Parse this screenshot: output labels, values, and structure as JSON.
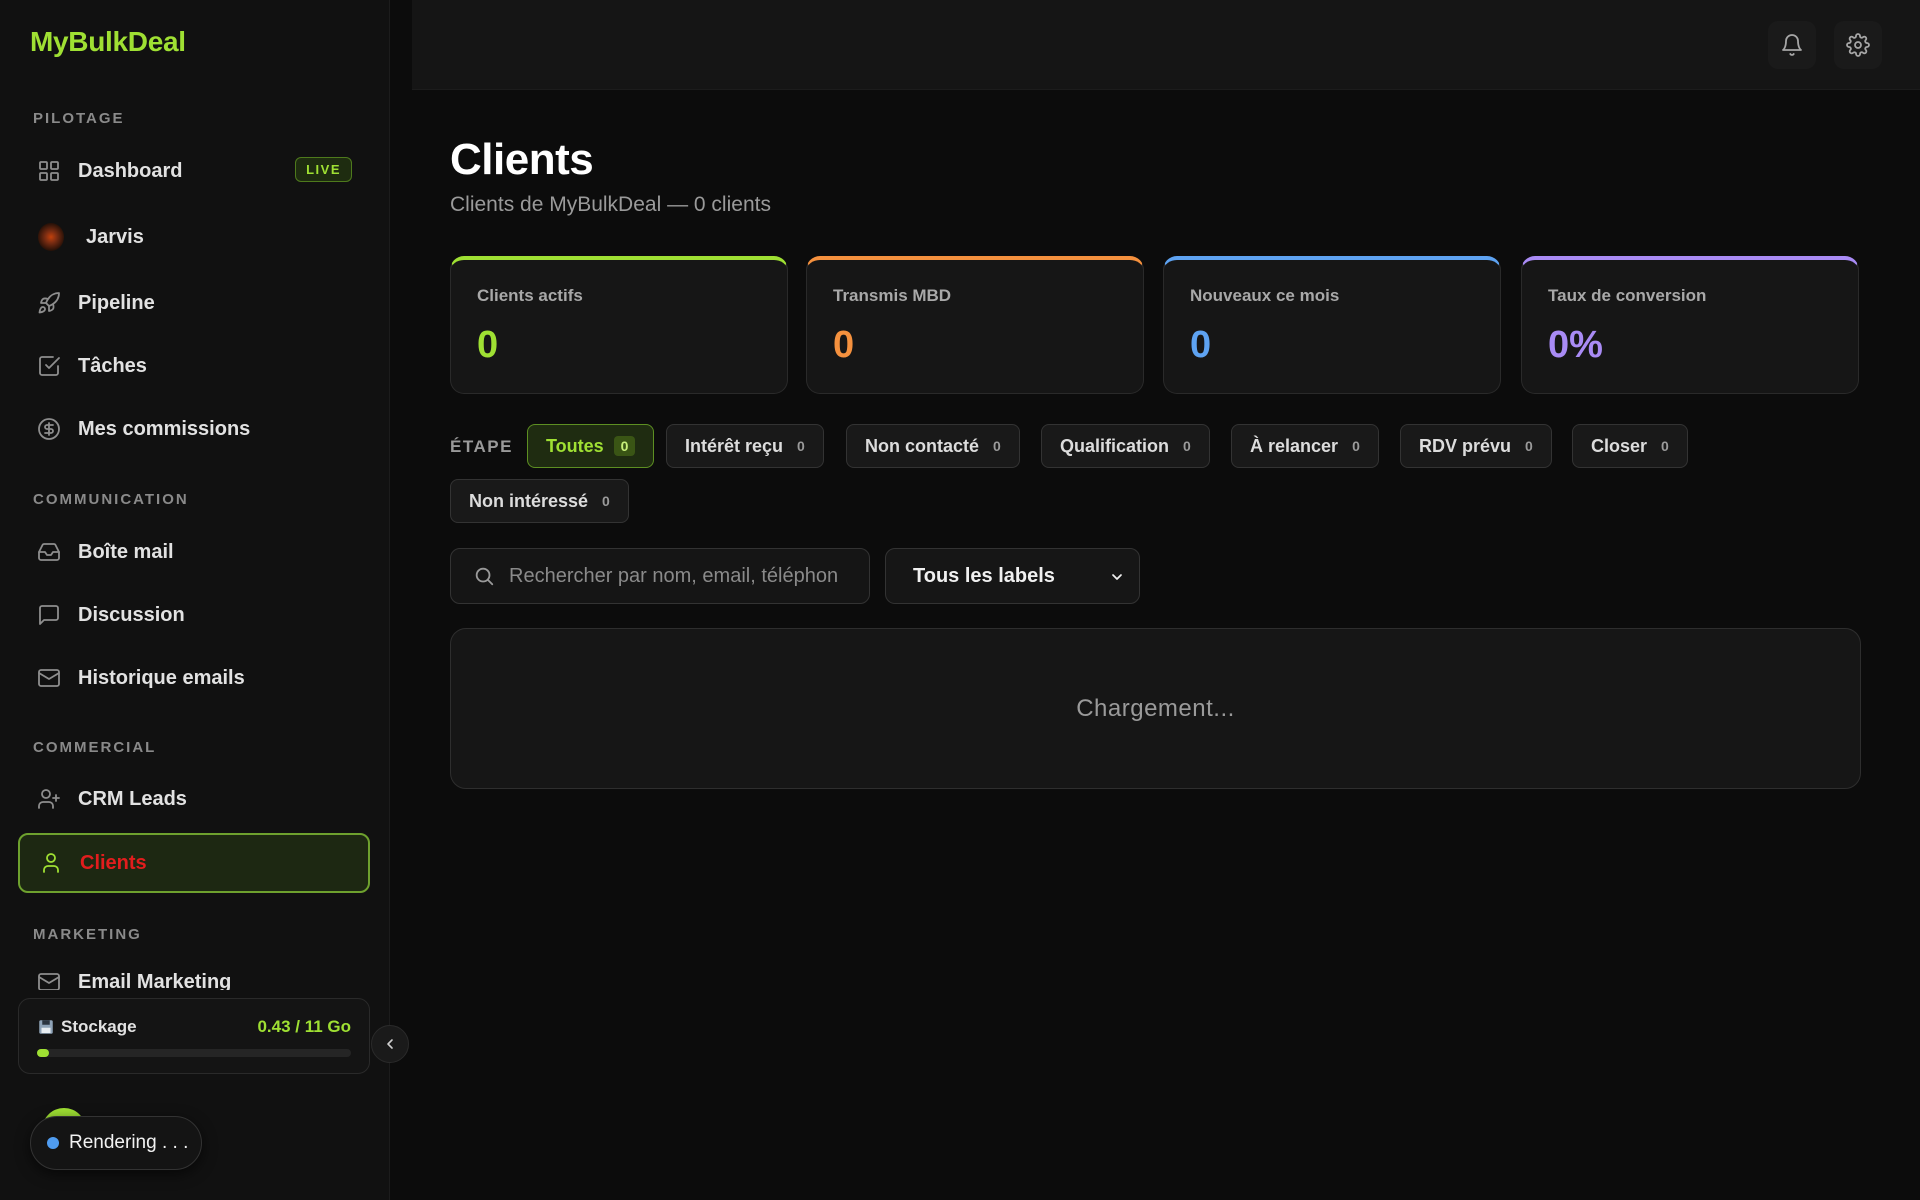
{
  "brand": "MyBulkDeal",
  "sidebar": {
    "sections": {
      "pilotage": "PILOTAGE",
      "communication": "COMMUNICATION",
      "commercial": "COMMERCIAL",
      "marketing": "MARKETING"
    },
    "items": {
      "dashboard": {
        "label": "Dashboard",
        "icon": "grid-icon",
        "badge": "LIVE"
      },
      "jarvis": {
        "label": "Jarvis",
        "icon": "jarvis-orb-icon"
      },
      "pipeline": {
        "label": "Pipeline",
        "icon": "rocket-icon"
      },
      "taches": {
        "label": "Tâches",
        "icon": "checkbox-icon"
      },
      "commissions": {
        "label": "Mes commissions",
        "icon": "dollar-circle-icon"
      },
      "boite_mail": {
        "label": "Boîte mail",
        "icon": "inbox-icon"
      },
      "discussion": {
        "label": "Discussion",
        "icon": "chat-icon"
      },
      "historique": {
        "label": "Historique emails",
        "icon": "mail-icon"
      },
      "crm_leads": {
        "label": "CRM Leads",
        "icon": "user-plus-icon"
      },
      "clients": {
        "label": "Clients",
        "icon": "user-icon",
        "active": true
      },
      "email_marketing": {
        "label": "Email Marketing",
        "icon": "mail-icon"
      }
    },
    "storage": {
      "label": "Stockage",
      "value": "0.43 / 11 Go",
      "fraction": 0.039
    },
    "rendering": "Rendering . . ."
  },
  "header": {
    "icons": [
      "bell-icon",
      "gear-icon"
    ]
  },
  "main": {
    "title": "Clients",
    "subtitle": "Clients de MyBulkDeal — 0 clients",
    "stats": [
      {
        "label": "Clients actifs",
        "value": "0",
        "color": "#9fe033"
      },
      {
        "label": "Transmis MBD",
        "value": "0",
        "color": "#f5913e"
      },
      {
        "label": "Nouveaux ce mois",
        "value": "0",
        "color": "#5ea3f2"
      },
      {
        "label": "Taux de conversion",
        "value": "0%",
        "color": "#a98bf5"
      }
    ],
    "etape_label": "ÉTAPE",
    "chips": [
      {
        "label": "Toutes",
        "count": "0",
        "active": true
      },
      {
        "label": "Intérêt reçu",
        "count": "0"
      },
      {
        "label": "Non contacté",
        "count": "0"
      },
      {
        "label": "Qualification",
        "count": "0"
      },
      {
        "label": "À relancer",
        "count": "0"
      },
      {
        "label": "RDV prévu",
        "count": "0"
      },
      {
        "label": "Closer",
        "count": "0"
      },
      {
        "label": "Non intéressé",
        "count": "0"
      }
    ],
    "search_placeholder": "Rechercher par nom, email, téléphon",
    "labels_select": "Tous les labels",
    "loading_text": "Chargement..."
  }
}
